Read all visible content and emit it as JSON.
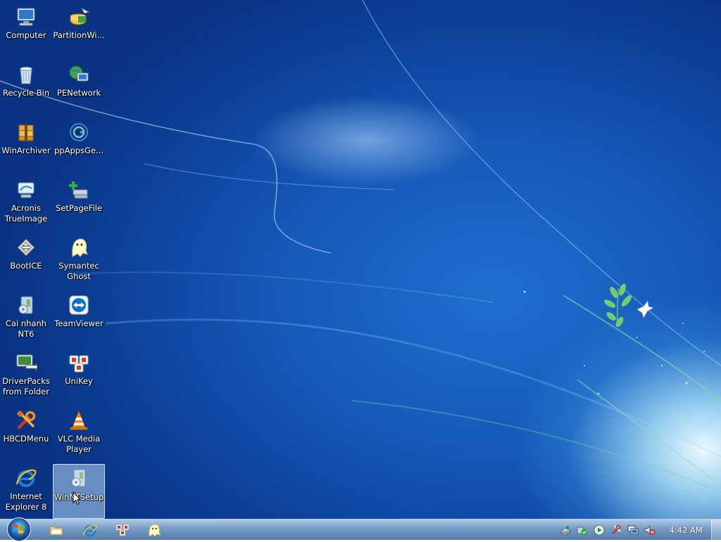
{
  "desktop": {
    "icons": [
      {
        "label": "Computer",
        "icon": "computer-icon"
      },
      {
        "label": "PartitionWi...",
        "icon": "partition-wizard-icon"
      },
      {
        "label": "Recycle Bin",
        "icon": "recycle-bin-icon"
      },
      {
        "label": "PENetwork",
        "icon": "network-icon"
      },
      {
        "label": "WinArchiver",
        "icon": "archiver-icon"
      },
      {
        "label": "ppAppsGe...",
        "icon": "ppapps-icon"
      },
      {
        "label": "Acronis\nTrueImage",
        "icon": "acronis-icon"
      },
      {
        "label": "SetPageFile",
        "icon": "setpagefile-icon"
      },
      {
        "label": "BootICE",
        "icon": "bootice-icon"
      },
      {
        "label": "Symantec\nGhost",
        "icon": "ghost-icon"
      },
      {
        "label": "Cai nhanh\nNT6",
        "icon": "cai-nhanh-icon"
      },
      {
        "label": "TeamViewer",
        "icon": "teamviewer-icon"
      },
      {
        "label": "DriverPacks\nfrom Folder",
        "icon": "driverpacks-icon"
      },
      {
        "label": "UniKey",
        "icon": "unikey-icon"
      },
      {
        "label": "HBCDMenu",
        "icon": "hbcdmenu-icon"
      },
      {
        "label": "VLC Media\nPlayer",
        "icon": "vlc-icon"
      },
      {
        "label": "Internet\nExplorer 8",
        "icon": "internet-explorer-icon"
      },
      {
        "label": "WinNTSetup",
        "icon": "winntsetup-icon",
        "selected": true
      }
    ]
  },
  "taskbar": {
    "start_icon": "windows-orb-icon",
    "pinned": [
      "folder-icon",
      "internet-explorer-icon",
      "unikey-icon",
      "ghost-icon"
    ],
    "tray": [
      "usb-drive-icon",
      "security-shield-icon",
      "media-play-icon",
      "network-tool-icon",
      "network-monitor-icon",
      "volume-muted-icon"
    ],
    "clock": "4:42 AM"
  },
  "colors": {
    "desktop_blue": "#0c3f96",
    "taskbar": "#6e96c3",
    "selection": "#b4d7f5"
  }
}
